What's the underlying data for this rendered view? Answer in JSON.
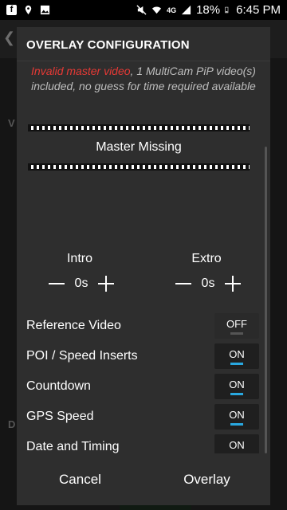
{
  "status_bar": {
    "battery": "18%",
    "time": "6:45 PM",
    "network": "4G",
    "icons_left": [
      "facebook-icon",
      "location-icon",
      "image-icon"
    ],
    "icons_right": [
      "mute-icon",
      "wifi-icon",
      "signal-icon",
      "battery-icon"
    ]
  },
  "background": {
    "section_1": "V",
    "section_2": "D"
  },
  "dialog": {
    "title": "OVERLAY CONFIGURATION",
    "message_error": "Invalid master video",
    "message_rest": ", 1 MultiCam PiP video(s) included, no guess for time required available",
    "master_label": "Master Missing",
    "intro": {
      "label": "Intro",
      "value": "0s"
    },
    "extro": {
      "label": "Extro",
      "value": "0s"
    },
    "options": [
      {
        "label": "Reference Video",
        "state": "OFF"
      },
      {
        "label": "POI / Speed Inserts",
        "state": "ON"
      },
      {
        "label": "Countdown",
        "state": "ON"
      },
      {
        "label": "GPS Speed",
        "state": "ON"
      },
      {
        "label": "Date and Timing",
        "state": "ON"
      }
    ],
    "cancel_label": "Cancel",
    "ok_label": "Overlay"
  },
  "colors": {
    "error": "#e53935",
    "toggle_on": "#29a8e0",
    "dialog_bg": "#2e2e2e"
  }
}
